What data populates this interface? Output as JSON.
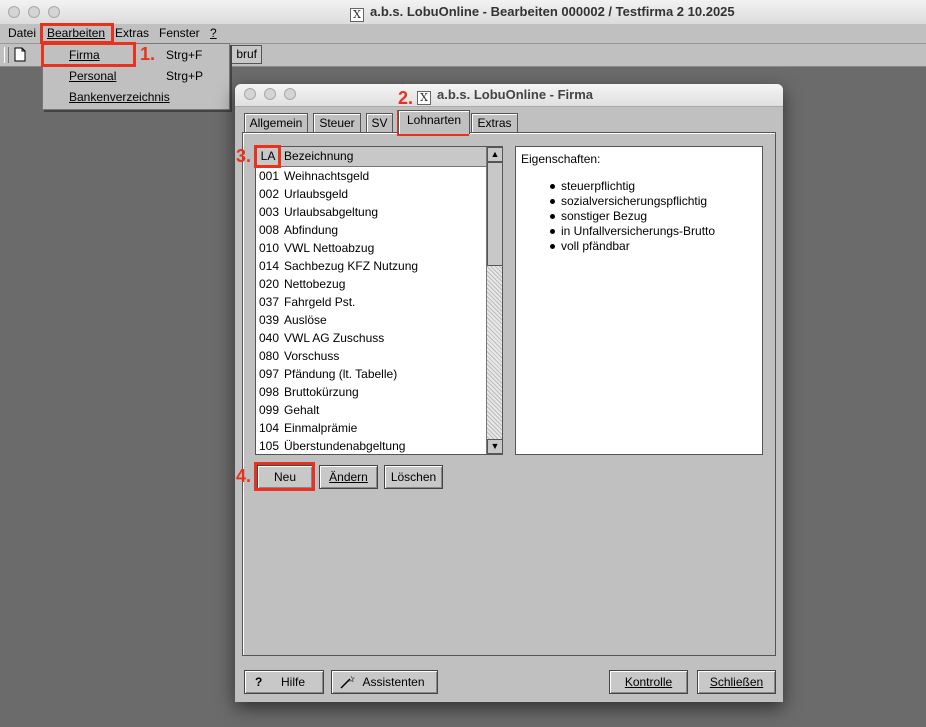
{
  "window": {
    "title": "a.b.s. LobuOnline - Bearbeiten 000002 / Testfirma 2 10.2025",
    "x_glyph": "X"
  },
  "menubar": {
    "items": [
      {
        "label": "Datei"
      },
      {
        "label": "Bearbeiten"
      },
      {
        "label": "Extras"
      },
      {
        "label": "Fenster"
      },
      {
        "label": "?"
      }
    ]
  },
  "toolbar": {
    "partial_button": "bruf"
  },
  "edit_menu": {
    "items": [
      {
        "label": "Firma",
        "shortcut": "Strg+F"
      },
      {
        "label": "Personal",
        "shortcut": "Strg+P"
      },
      {
        "label": "Bankenverzeichnis",
        "shortcut": ""
      }
    ]
  },
  "annotations": {
    "step1": "1.",
    "step2": "2.",
    "step3": "3.",
    "step4": "4.",
    "color": "#e8321e"
  },
  "dialog": {
    "title": "a.b.s. LobuOnline - Firma",
    "tabs": [
      {
        "label": "Allgemein"
      },
      {
        "label": "Steuer"
      },
      {
        "label": "SV"
      },
      {
        "label": "Lohnarten",
        "active": true
      },
      {
        "label": "Extras"
      }
    ],
    "list": {
      "col_la": "LA",
      "col_bezeichnung": "Bezeichnung",
      "rows": [
        {
          "la": "001",
          "bez": "Weihnachtsgeld"
        },
        {
          "la": "002",
          "bez": "Urlaubsgeld"
        },
        {
          "la": "003",
          "bez": "Urlaubsabgeltung"
        },
        {
          "la": "008",
          "bez": "Abfindung"
        },
        {
          "la": "010",
          "bez": "VWL Nettoabzug"
        },
        {
          "la": "014",
          "bez": "Sachbezug KFZ Nutzung"
        },
        {
          "la": "020",
          "bez": "Nettobezug"
        },
        {
          "la": "037",
          "bez": "Fahrgeld Pst."
        },
        {
          "la": "039",
          "bez": "Auslöse"
        },
        {
          "la": "040",
          "bez": "VWL AG Zuschuss"
        },
        {
          "la": "080",
          "bez": "Vorschuss"
        },
        {
          "la": "097",
          "bez": "Pfändung (lt. Tabelle)"
        },
        {
          "la": "098",
          "bez": "Bruttokürzung"
        },
        {
          "la": "099",
          "bez": "Gehalt"
        },
        {
          "la": "104",
          "bez": "Einmalprämie"
        },
        {
          "la": "105",
          "bez": "Überstundenabgeltung"
        }
      ]
    },
    "properties": {
      "title": "Eigenschaften:",
      "items": [
        "steuerpflichtig",
        "sozialversicherungspflichtig",
        "sonstiger Bezug",
        "in Unfallversicherungs-Brutto",
        "voll pfändbar"
      ]
    },
    "buttons": {
      "neu": "Neu",
      "aendern": "Ändern",
      "loeschen": "Löschen",
      "hilfe": "Hilfe",
      "hilfe_glyph": "?",
      "assistenten": "Assistenten",
      "kontrolle": "Kontrolle",
      "schliessen": "Schließen"
    }
  }
}
